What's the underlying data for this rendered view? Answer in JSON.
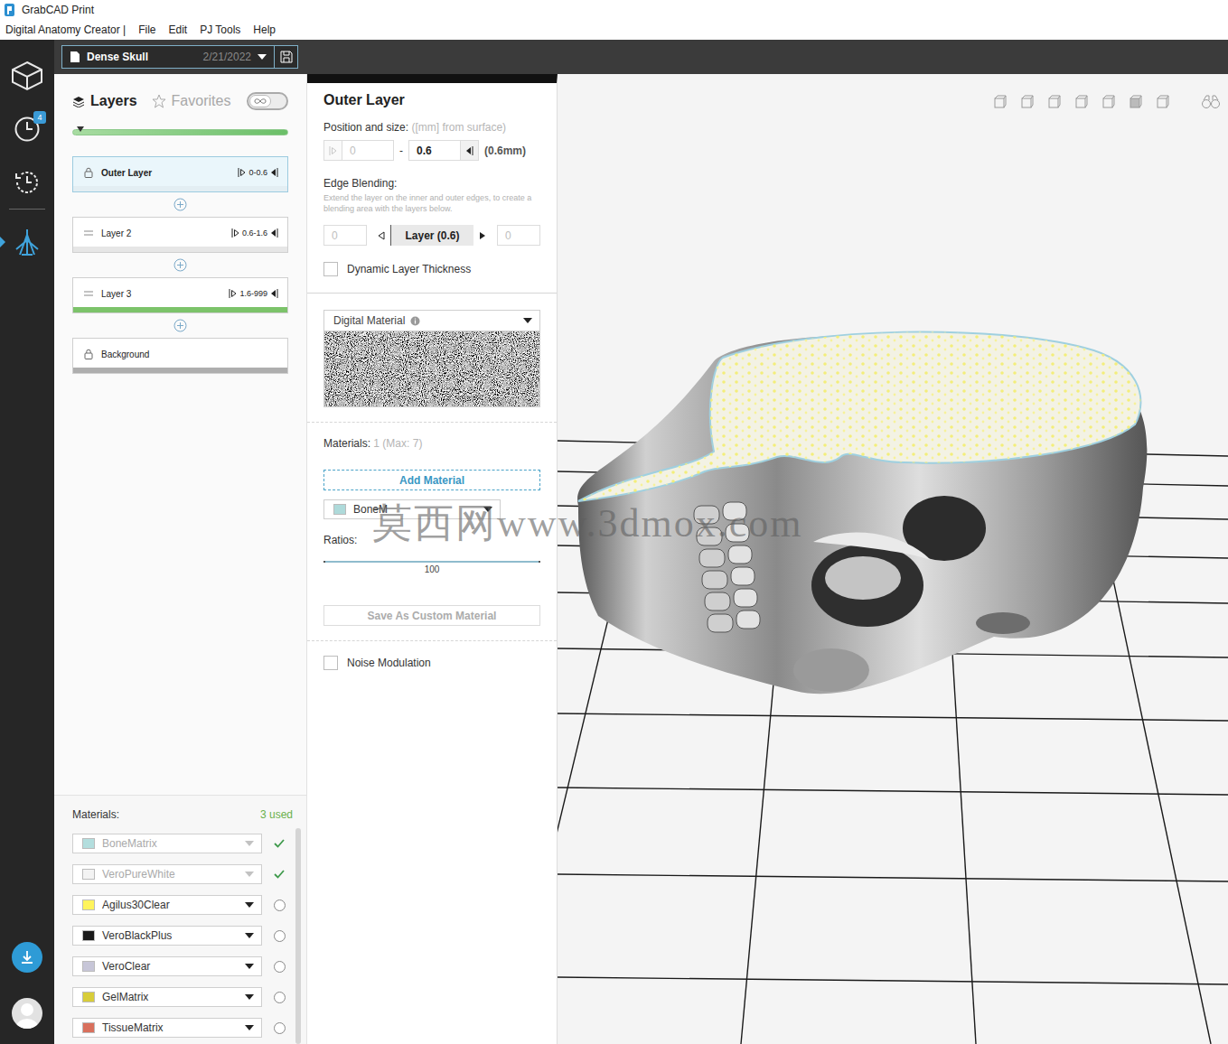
{
  "window": {
    "title": "GrabCAD Print"
  },
  "menu": [
    "Digital Anatomy Creator |",
    "File",
    "Edit",
    "PJ Tools",
    "Help"
  ],
  "rail": {
    "items": [
      {
        "selected": false,
        "badge": ""
      },
      {
        "selected": false,
        "badge": "4"
      },
      {
        "selected": false,
        "badge": ""
      },
      {
        "selected": true,
        "badge": ""
      }
    ]
  },
  "job": {
    "name": "Dense Skull",
    "date": "2/21/2022"
  },
  "layer_tabs": [
    {
      "label": "Layers",
      "selected": true
    },
    {
      "label": "Favorites",
      "selected": false
    }
  ],
  "infinity_toggle": {
    "on": false
  },
  "layer_slider": {
    "level": 0
  },
  "layers": [
    {
      "name": "Outer Layer",
      "range": "0-0.6",
      "locked": true,
      "selected": true,
      "color": "#e3eef3"
    },
    {
      "name": "Layer 2",
      "range": "0.6-1.6",
      "locked": false,
      "selected": false,
      "color": "#e6e6e6"
    },
    {
      "name": "Layer 3",
      "range": "1.6-999",
      "locked": false,
      "selected": false,
      "color": "#7cc36a"
    },
    {
      "name": "Background",
      "locked": true,
      "selected": false,
      "color": "#aeaeae"
    }
  ],
  "detail": {
    "title": "Outer Layer",
    "position_label": "Position and size:",
    "position_hint": "([mm] from surface)",
    "from": {
      "value": "0",
      "disabled": true
    },
    "dash": "-",
    "to": {
      "value": "0.6",
      "disabled": false
    },
    "size": "(0.6mm)",
    "edge_label": "Edge Blending:",
    "edge_hint": "Extend the layer on the inner and outer edges, to create a blending area with the layers below.",
    "edge_inner": "0",
    "edge_layer": "Layer (0.6)",
    "edge_outer": "0",
    "dynamic": {
      "label": "Dynamic Layer Thickness",
      "checked": false
    },
    "digital_material": "Digital Material",
    "materials_label": "Materials:",
    "materials_count": "1 (Max: 7)",
    "add_material": "Add Material",
    "material_rows": [
      {
        "name": "BoneM",
        "color": "#aedada"
      }
    ],
    "ratios_label": "Ratios:",
    "ratio": {
      "value": "100",
      "level": 1
    },
    "save_custom": {
      "label": "Save As Custom Material",
      "disabled": true
    },
    "noise": {
      "label": "Noise Modulation",
      "checked": false
    }
  },
  "materials": {
    "label": "Materials:",
    "count": "3 used",
    "items": [
      {
        "name": "BoneMatrix",
        "color": "#b3dede",
        "used": true,
        "disabled": true
      },
      {
        "name": "VeroPureWhite",
        "color": "#f3f3f3",
        "used": true,
        "disabled": true
      },
      {
        "name": "Agilus30Clear",
        "color": "#fff45c",
        "used": false,
        "disabled": false
      },
      {
        "name": "VeroBlackPlus",
        "color": "#1a1a1a",
        "used": false,
        "disabled": false
      },
      {
        "name": "VeroClear",
        "color": "#c7c6d8",
        "used": false,
        "disabled": false
      },
      {
        "name": "GelMatrix",
        "color": "#d8cd3a",
        "used": false,
        "disabled": false
      },
      {
        "name": "TissueMatrix",
        "color": "#d9705d",
        "used": false,
        "disabled": false
      }
    ]
  },
  "watermark": "莫西网www.3dmox.com"
}
